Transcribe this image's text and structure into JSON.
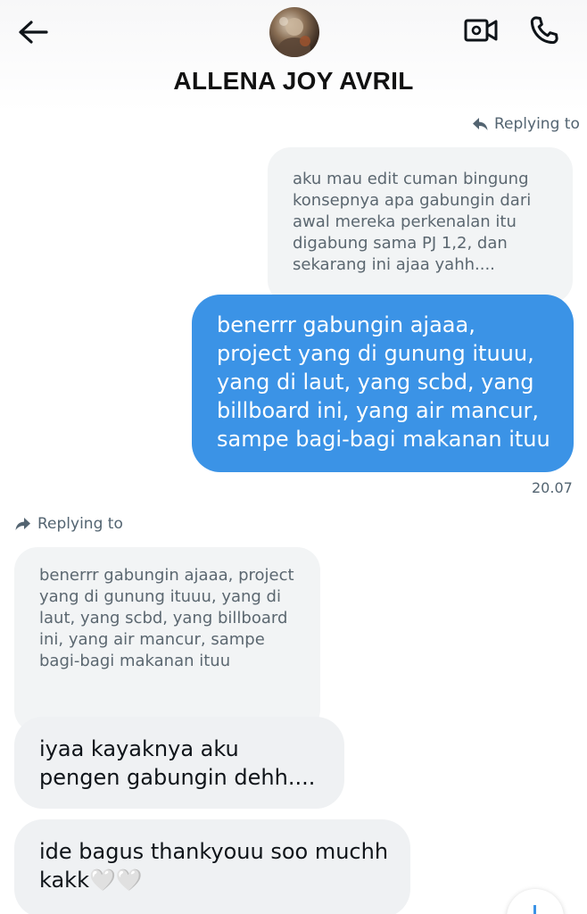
{
  "header": {
    "contact_name": "ALLENA JOY AVRIL",
    "back_icon": "arrow-left-icon",
    "video_icon": "video-camera-icon",
    "call_icon": "phone-icon"
  },
  "messages": {
    "sent_reply_label": "Replying to",
    "sent_quote_text": "aku mau edit cuman bingung konsepnya apa gabungin dari awal mereka perkenalan itu digabung sama PJ 1,2, dan sekarang ini ajaa yahh....",
    "sent_text": "benerrr gabungin ajaaa, project yang di gunung ituuu, yang di laut, yang scbd, yang billboard ini, yang air mancur, sampe bagi-bagi makanan ituu",
    "sent_time": "20.07",
    "recv_reply_label": "Replying to",
    "recv_quote_text": "benerrr gabungin ajaaa, project yang di gunung ituuu, yang di laut, yang scbd, yang billboard ini, yang air mancur, sampe bagi-bagi makanan ituu",
    "recv_text_1": "iyaa kayaknya aku pengen gabungin dehh....",
    "recv_text_2": "ide bagus thankyouu soo muchh kakk🤍🤍"
  },
  "colors": {
    "sent_bubble": "#3b93e6",
    "received_bubble": "#eff1f3",
    "quote_bubble": "#f2f4f5",
    "secondary_text": "#536471"
  }
}
